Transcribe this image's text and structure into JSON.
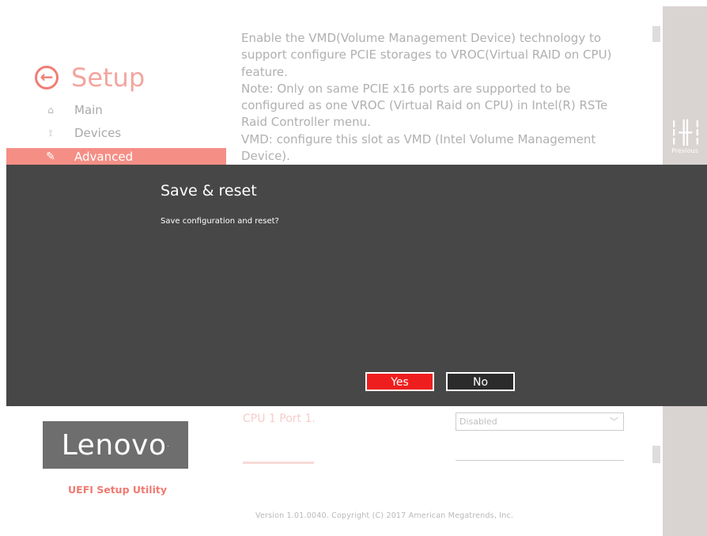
{
  "app": {
    "title": "Setup",
    "back_icon": "arrow-left-circle-icon"
  },
  "nav": {
    "items": [
      {
        "label": "Main",
        "icon": "home-icon",
        "glyph": "⌂"
      },
      {
        "label": "Devices",
        "icon": "devices-icon",
        "glyph": "⟟"
      },
      {
        "label": "Advanced",
        "icon": "wrench-icon",
        "glyph": "✎",
        "active": true
      }
    ]
  },
  "help": {
    "paragraphs": [
      "Enable the VMD(Volume Management Device) technology to support configure PCIE storages to VROC(Virtual RAID on CPU) feature.",
      "Note: Only on same PCIE x16 ports are supported to be configured as one VROC (Virtual Raid on CPU) in Intel(R) RSTe Raid Controller menu.",
      "VMD: configure this slot as VMD (Intel Volume Management Device)."
    ]
  },
  "right_panel": {
    "tool_label": "Previous",
    "icon": "sliders-icon"
  },
  "dialog": {
    "title": "Save & reset",
    "message": "Save configuration and reset?",
    "yes_label": "Yes",
    "no_label": "No"
  },
  "settings": {
    "port1_label": "CPU 1 Port 1.",
    "port1_value": "Disabled"
  },
  "brand": {
    "logo_text": "Lenovo",
    "logo_suffix": ".",
    "utility_name": "UEFI Setup Utility"
  },
  "footer": {
    "version": "Version 1.01.0040. Copyright (C) 2017 American Megatrends, Inc."
  },
  "colors": {
    "accent": "#f58f86",
    "dialog_bg": "#474747",
    "yes_button": "#ee1e1e"
  }
}
